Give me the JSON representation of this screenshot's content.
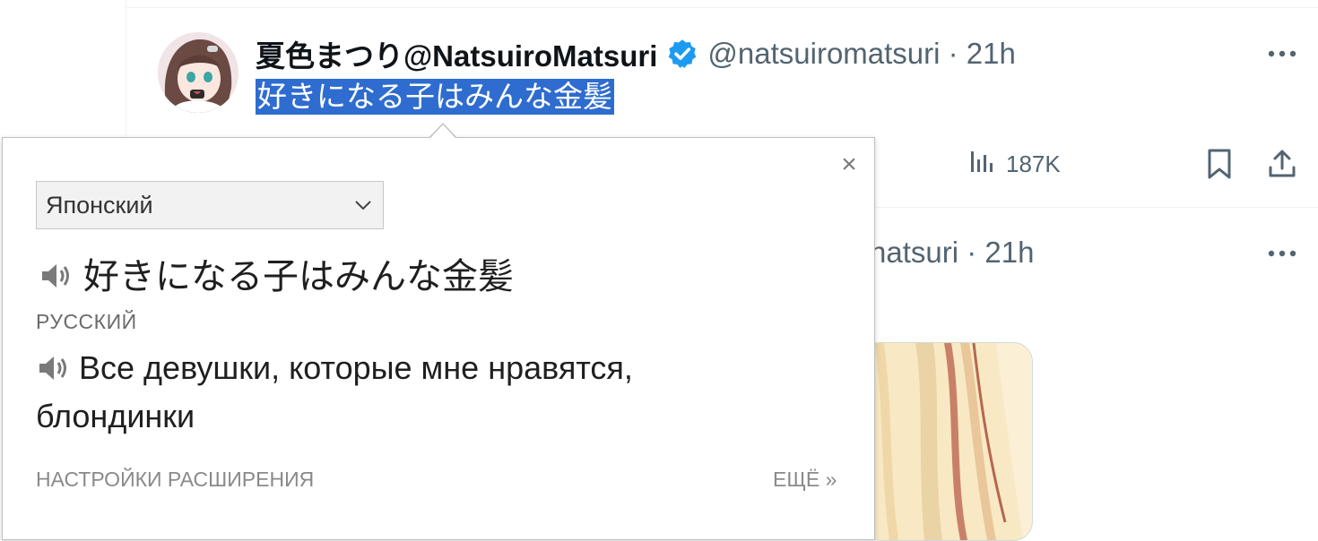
{
  "tweet1": {
    "display_name": "夏色まつり@NatsuiroMatsuri",
    "handle_meta": "@natsuiromatsuri · 21h",
    "text": "好きになる子はみんな金髪",
    "views": "187K"
  },
  "tweet2": {
    "handle_meta": "natsuri · 21h"
  },
  "popup": {
    "source_language": "Японский",
    "source_text": "好きになる子はみんな金髪",
    "target_language": "РУССКИЙ",
    "translation": "Все девушки, которые мне нравятся, блондинки",
    "close_label": "×",
    "settings_label": "НАСТРОЙКИ РАСШИРЕНИЯ",
    "more_label": "ЕЩЁ »"
  },
  "colors": {
    "selection": "#2f6ccf",
    "verified": "#1d9bf0",
    "secondary_text": "#536471",
    "popup_border": "#bfbfbf"
  },
  "icons": [
    "verified-icon",
    "more-icon",
    "views-icon",
    "bookmark-icon",
    "share-icon",
    "speaker-icon",
    "chevron-down-icon",
    "close-icon"
  ]
}
